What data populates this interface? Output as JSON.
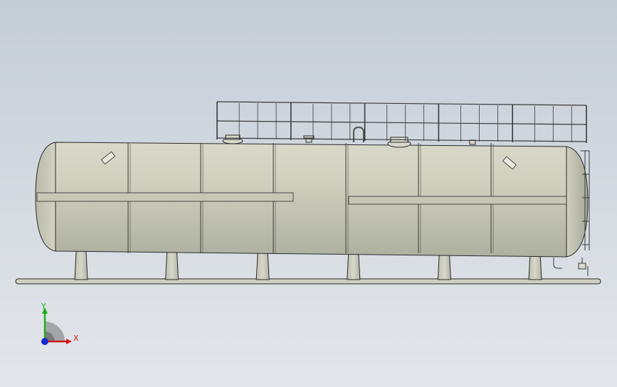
{
  "viewport": {
    "background_top": "#c4ccd6",
    "background_bottom": "#e3e6ea"
  },
  "model": {
    "tank_color": "#c9cab8",
    "edge_color": "#2a2a2a",
    "support_count": 6,
    "railing_panels": 5
  },
  "triad": {
    "x_label": "X",
    "y_label": "Y",
    "x_color": "#d01818",
    "y_color": "#18b018",
    "z_color": "#1828d0"
  }
}
